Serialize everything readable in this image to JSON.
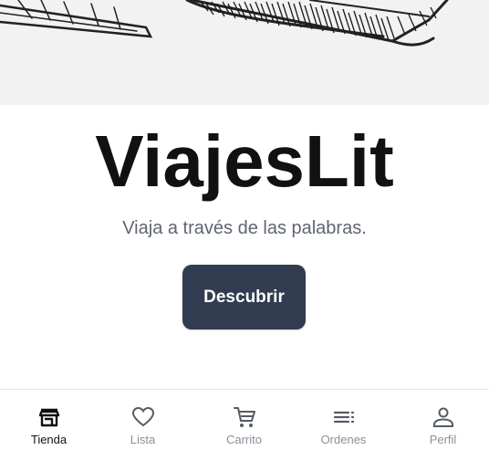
{
  "hero": {
    "image": "hand-drawn-book-sketch"
  },
  "brand": {
    "title": "ViajesLit",
    "tagline": "Viaja a través de las palabras."
  },
  "cta": {
    "label": "Descubrir"
  },
  "nav": {
    "active": "Tienda",
    "items": [
      {
        "label": "Tienda",
        "icon": "store-icon"
      },
      {
        "label": "Lista",
        "icon": "heart-icon"
      },
      {
        "label": "Carrito",
        "icon": "cart-icon"
      },
      {
        "label": "Ordenes",
        "icon": "list-icon"
      },
      {
        "label": "Perfil",
        "icon": "person-icon"
      }
    ]
  },
  "colors": {
    "cta_bg": "#323c50",
    "text_dark": "#111111",
    "muted": "#8a8f98"
  }
}
